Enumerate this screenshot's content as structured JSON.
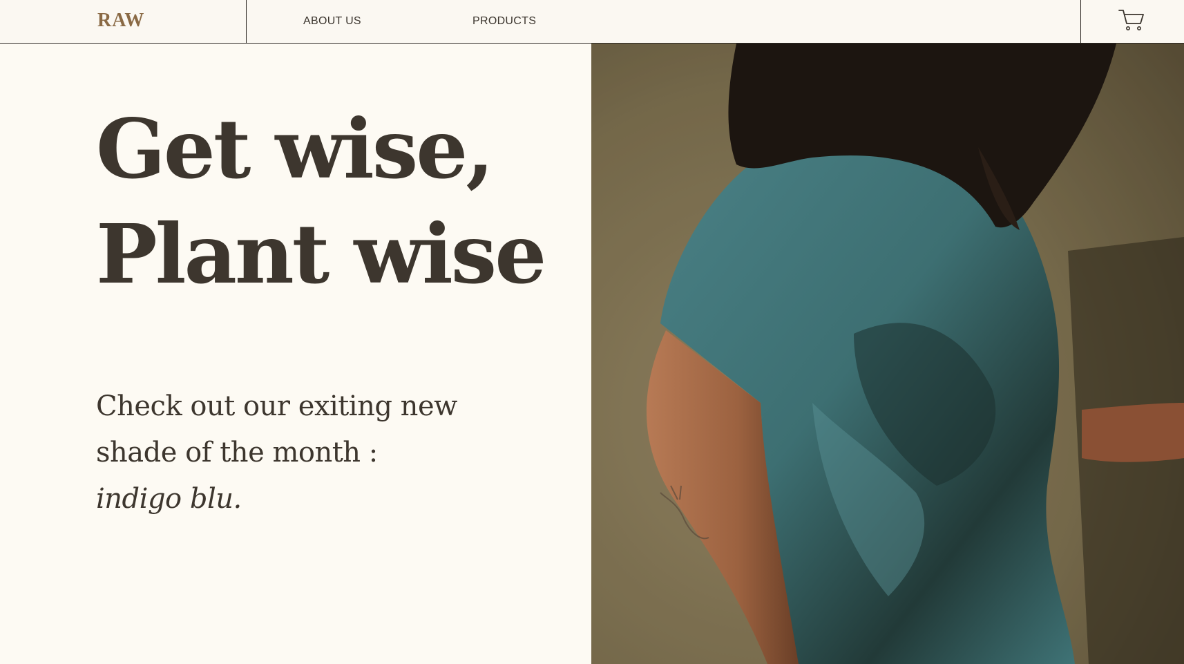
{
  "header": {
    "logo": "RAW",
    "nav": [
      {
        "label": "ABOUT US"
      },
      {
        "label": "PRODUCTS"
      }
    ],
    "cart_icon": "cart-icon"
  },
  "hero": {
    "headline_line1": "Get wise,",
    "headline_line2": "Plant wise",
    "sub_line1": "Check out our exiting new",
    "sub_line2": "shade of the month :",
    "sub_line3": "indigo blu.",
    "image_subject": "person wearing teal t-shirt"
  },
  "colors": {
    "background": "#fdfaf3",
    "logo": "#8a6a45",
    "text": "#3d362e",
    "shirt": "#3f6f73"
  }
}
